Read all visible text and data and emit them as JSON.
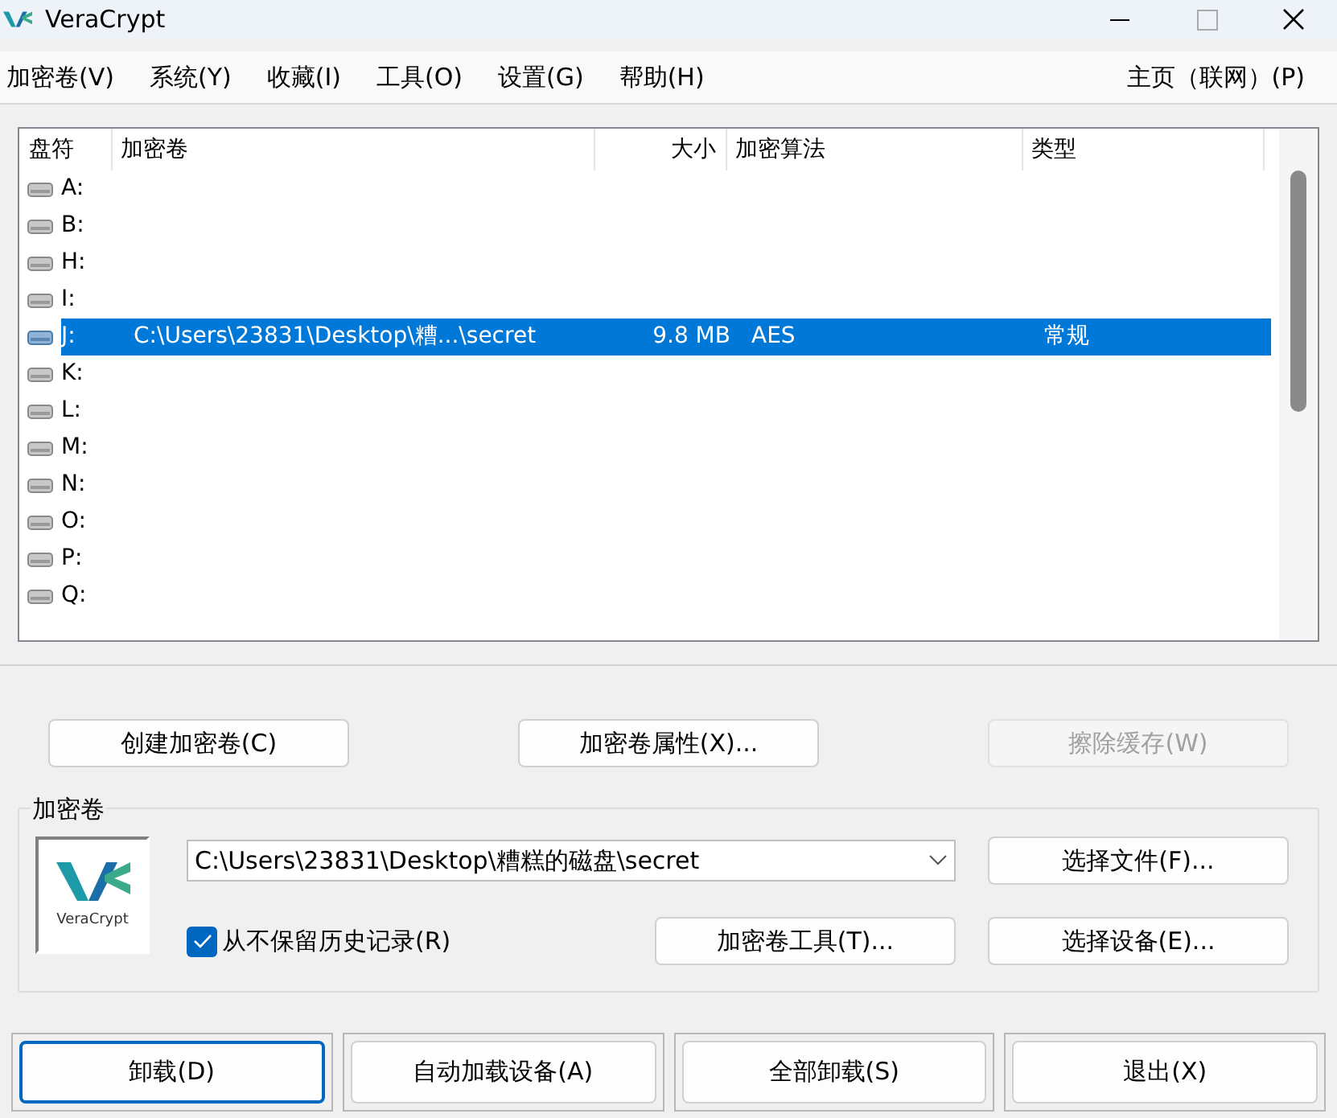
{
  "window": {
    "title": "VeraCrypt"
  },
  "menu": [
    {
      "label": "加密卷(V)"
    },
    {
      "label": "系统(Y)"
    },
    {
      "label": "收藏(I)"
    },
    {
      "label": "工具(O)"
    },
    {
      "label": "设置(G)"
    },
    {
      "label": "帮助(H)"
    }
  ],
  "menu_right": "主页（联网）(P)",
  "table": {
    "columns": [
      "盘符",
      "加密卷",
      "大小",
      "加密算法",
      "类型"
    ],
    "rows": [
      {
        "drive": "A:",
        "volume": "",
        "size": "",
        "algorithm": "",
        "type": "",
        "selected": false
      },
      {
        "drive": "B:",
        "volume": "",
        "size": "",
        "algorithm": "",
        "type": "",
        "selected": false
      },
      {
        "drive": "H:",
        "volume": "",
        "size": "",
        "algorithm": "",
        "type": "",
        "selected": false
      },
      {
        "drive": "I:",
        "volume": "",
        "size": "",
        "algorithm": "",
        "type": "",
        "selected": false
      },
      {
        "drive": "J:",
        "volume": "C:\\Users\\23831\\Desktop\\糟...\\secret",
        "size": "9.8 MB",
        "algorithm": "AES",
        "type": "常规",
        "selected": true
      },
      {
        "drive": "K:",
        "volume": "",
        "size": "",
        "algorithm": "",
        "type": "",
        "selected": false
      },
      {
        "drive": "L:",
        "volume": "",
        "size": "",
        "algorithm": "",
        "type": "",
        "selected": false
      },
      {
        "drive": "M:",
        "volume": "",
        "size": "",
        "algorithm": "",
        "type": "",
        "selected": false
      },
      {
        "drive": "N:",
        "volume": "",
        "size": "",
        "algorithm": "",
        "type": "",
        "selected": false
      },
      {
        "drive": "O:",
        "volume": "",
        "size": "",
        "algorithm": "",
        "type": "",
        "selected": false
      },
      {
        "drive": "P:",
        "volume": "",
        "size": "",
        "algorithm": "",
        "type": "",
        "selected": false
      },
      {
        "drive": "Q:",
        "volume": "",
        "size": "",
        "algorithm": "",
        "type": "",
        "selected": false
      }
    ]
  },
  "actions": [
    {
      "label": "创建加密卷(C)",
      "disabled": false
    },
    {
      "label": "加密卷属性(X)...",
      "disabled": false
    },
    {
      "label": "擦除缓存(W)",
      "disabled": true
    }
  ],
  "volume_group": {
    "label": "加密卷",
    "logo_text": "VeraCrypt",
    "path": "C:\\Users\\23831\\Desktop\\糟糕的磁盘\\secret",
    "never_save_history": {
      "label": "从不保留历史记录(R)",
      "checked": true
    },
    "select_file": "选择文件(F)...",
    "volume_tools": "加密卷工具(T)...",
    "select_device": "选择设备(E)..."
  },
  "bottom_buttons": [
    {
      "label": "卸载(D)",
      "selected": true
    },
    {
      "label": "自动加载设备(A)",
      "selected": false
    },
    {
      "label": "全部卸载(S)",
      "selected": false
    },
    {
      "label": "退出(X)",
      "selected": false
    }
  ]
}
